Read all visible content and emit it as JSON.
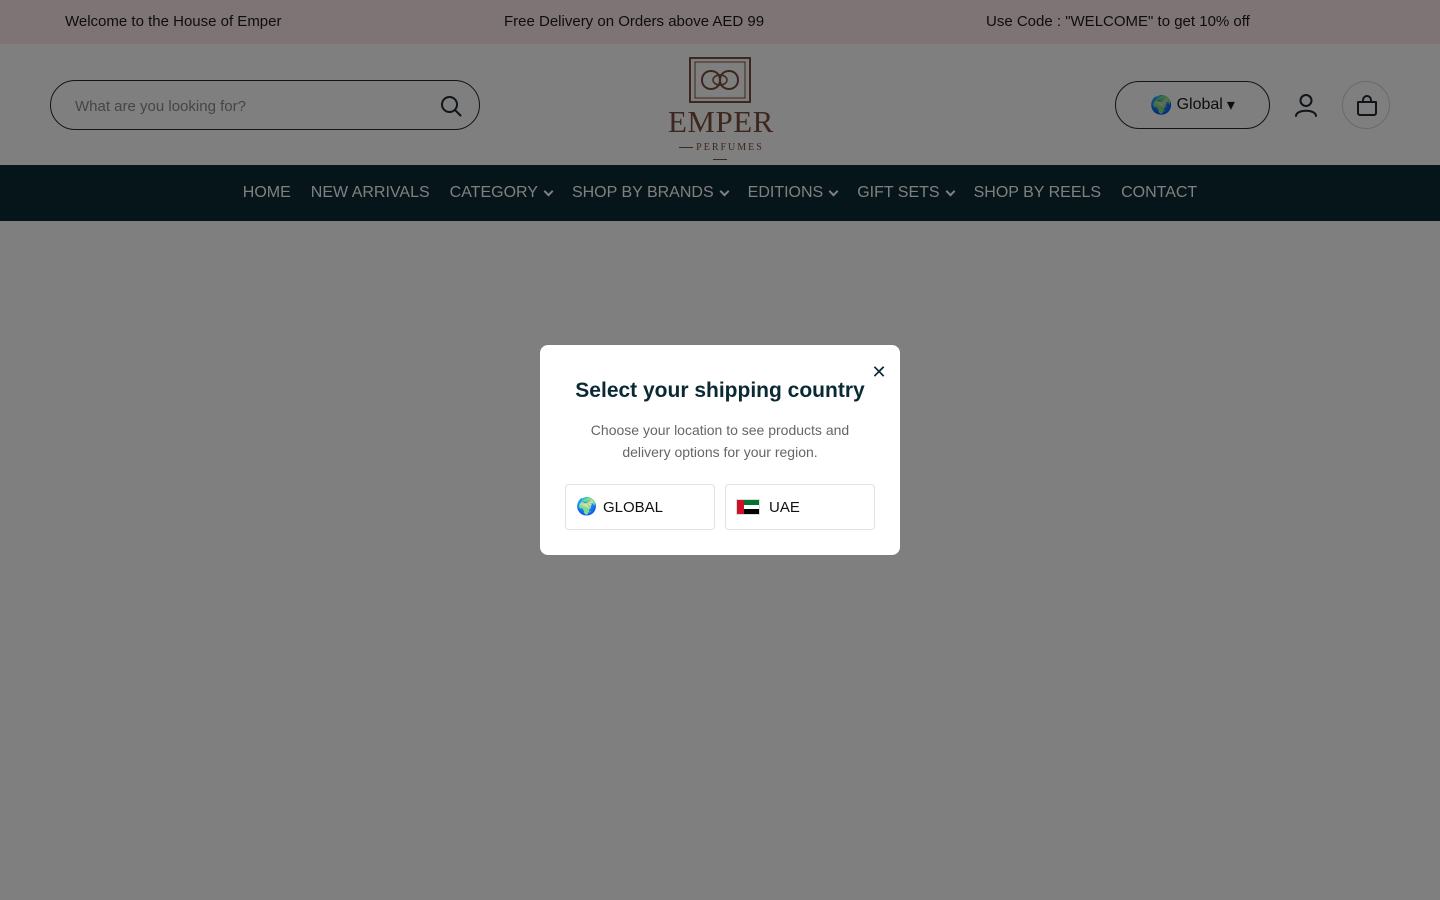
{
  "announcement": {
    "items": [
      "Welcome to the House of Emper",
      "Free Delivery on Orders above AED 99",
      "Use Code : \"WELCOME\" to get 10% off"
    ],
    "background": "#fce9ec"
  },
  "header": {
    "search": {
      "placeholder": "What are you looking for?",
      "icon": "search-icon"
    },
    "logo": {
      "brand": "EMPER",
      "sub": "PERFUMES",
      "color": "#7a4f3d"
    },
    "region": {
      "label": "Global",
      "icon": "globe-icon",
      "caret": "▾"
    },
    "account_icon": "user-icon",
    "cart_icon": "bag-icon"
  },
  "nav": {
    "background": "#0a2a33",
    "items": [
      {
        "label": "HOME",
        "dropdown": false
      },
      {
        "label": "NEW ARRIVALS",
        "dropdown": false
      },
      {
        "label": "CATEGORY",
        "dropdown": true
      },
      {
        "label": "SHOP BY BRANDS",
        "dropdown": true
      },
      {
        "label": "EDITIONS",
        "dropdown": true
      },
      {
        "label": "GIFT SETS",
        "dropdown": true
      },
      {
        "label": "SHOP BY REELS",
        "dropdown": false
      },
      {
        "label": "CONTACT",
        "dropdown": false
      }
    ]
  },
  "modal": {
    "title": "Select your shipping country",
    "description": "Choose your location to see products and delivery options for your region.",
    "close_label": "✕",
    "options": [
      {
        "label": "GLOBAL",
        "icon": "globe-icon"
      },
      {
        "label": "UAE",
        "icon": "uae-flag-icon"
      }
    ]
  }
}
